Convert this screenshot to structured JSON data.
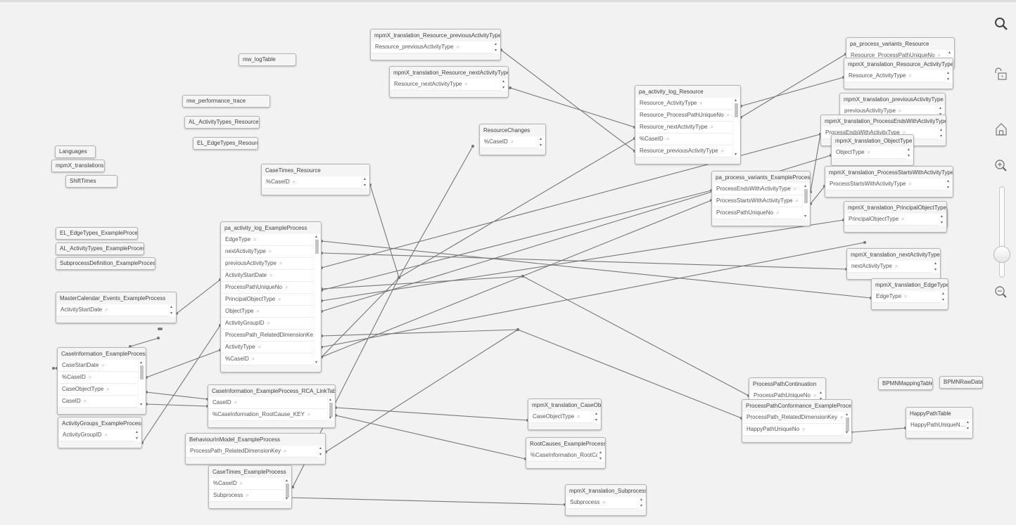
{
  "tables": [
    {
      "name": "mw_logTable",
      "fields": []
    },
    {
      "name": "mw_performance_trace",
      "fields": []
    },
    {
      "name": "AL_ActivityTypes_Resource",
      "fields": []
    },
    {
      "name": "EL_EdgeTypes_Resource",
      "fields": []
    },
    {
      "name": "Languages",
      "fields": []
    },
    {
      "name": "mpmX_translations",
      "fields": []
    },
    {
      "name": "ShiftTimes",
      "fields": []
    },
    {
      "name": "EL_EdgeTypes_ExampleProcess",
      "fields": []
    },
    {
      "name": "AL_ActivityTypes_ExampleProcess",
      "fields": []
    },
    {
      "name": "SubprocessDefinition_ExampleProcess",
      "fields": []
    },
    {
      "name": "BPMNMappingTable",
      "fields": []
    },
    {
      "name": "BPMNRawData",
      "fields": []
    },
    {
      "name": "mpmX_translation_Resource_previousActivityType",
      "fields": [
        "Resource_previousActivityType"
      ]
    },
    {
      "name": "mpmX_translation_Resource_nextActivityType",
      "fields": [
        "Resource_nextActivityType"
      ]
    },
    {
      "name": "ResourceChanges",
      "fields": [
        "%CaseID"
      ]
    },
    {
      "name": "pa_activity_log_Resource",
      "fields": [
        "Resource_ActivityType",
        "Resource_ProcessPathUniqueNo",
        "Resource_nextActivityType",
        "%CaseID",
        "Resource_previousActivityType"
      ]
    },
    {
      "name": "CaseTimes_Resource",
      "fields": [
        "%CaseID"
      ]
    },
    {
      "name": "pa_process_variants_Resource",
      "fields": [
        "Resource_ProcessPathUniqueNo"
      ]
    },
    {
      "name": "mpmX_translation_Resource_ActivityType",
      "fields": [
        "Resource_ActivityType"
      ]
    },
    {
      "name": "mpmX_translation_previousActivityType",
      "fields": [
        "previousActivityType"
      ]
    },
    {
      "name": "mpmX_translation_ProcessEndsWithActivityType",
      "fields": [
        "ProcessEndsWithActivityType"
      ]
    },
    {
      "name": "mpmX_translation_ObjectType",
      "fields": [
        "ObjectType"
      ]
    },
    {
      "name": "mpmX_translation_ProcessStartsWithActivityType",
      "fields": [
        "ProcessStartsWithActivityType"
      ]
    },
    {
      "name": "pa_process_variants_ExampleProcess",
      "fields": [
        "ProcessEndsWithActivityType",
        "ProcessStartsWithActivityType",
        "ProcessPathUniqueNo"
      ]
    },
    {
      "name": "",
      "fields": [
        "ActivityType"
      ]
    },
    {
      "name": "mpmX_translation_PrincipalObjectType",
      "fields": [
        "PrincipalObjectType"
      ]
    },
    {
      "name": "mpmX_translation_nextActivityType",
      "fields": [
        "nextActivityType"
      ]
    },
    {
      "name": "mpmX_translation_EdgeType",
      "fields": [
        "EdgeType"
      ]
    },
    {
      "name": "pa_activity_log_ExampleProcess",
      "fields": [
        "EdgeType",
        "nextActivityType",
        "previousActivityType",
        "ActivityStartDate",
        "ProcessPathUniqueNo",
        "PrincipalObjectType",
        "ObjectType",
        "ActivityGroupID",
        "ProcessPath_RelatedDimensionKe...",
        "ActivityType",
        "%CaseID"
      ]
    },
    {
      "name": "",
      "fields": [
        "CaseStartDate"
      ]
    },
    {
      "name": "MasterCalendar_Events_ExampleProcess",
      "fields": [
        "ActivityStartDate"
      ]
    },
    {
      "name": "CaseInformation_ExampleProcess",
      "fields": [
        "CaseStartDate",
        "%CaseID",
        "CaseObjectType",
        "CaseID"
      ]
    },
    {
      "name": "ActivityGroups_ExampleProcess",
      "fields": [
        "ActivityGroupID"
      ]
    },
    {
      "name": "CaseInformation_ExampleProcess_RCA_LinkTable",
      "fields": [
        "CaseID",
        "%CaseInformation_RootCause_KEY"
      ]
    },
    {
      "name": "BehaviourInModel_ExampleProcess",
      "fields": [
        "ProcessPath_RelatedDimensionKey"
      ]
    },
    {
      "name": "CaseTimes_ExampleProcess",
      "fields": [
        "%CaseID",
        "Subprocess"
      ]
    },
    {
      "name": "mpmX_translation_CaseObjectType",
      "fields": [
        "CaseObjectType"
      ]
    },
    {
      "name": "RootCauses_ExampleProcess",
      "fields": [
        "%CaseInformation_RootCause_KE..."
      ]
    },
    {
      "name": "mpmX_translation_Subprocess",
      "fields": [
        "Subprocess"
      ]
    },
    {
      "name": "ProcessPathContinuation",
      "fields": [
        "ProcessPathUniqueNo"
      ]
    },
    {
      "name": "ProcessPathConformance_ExampleProcess",
      "fields": [
        "ProcessPath_RelatedDimensionKey",
        "HappyPathUniqueNo"
      ]
    },
    {
      "name": "HappyPathTable",
      "fields": [
        "HappyPathUniqueN..."
      ]
    }
  ],
  "toolbar": {
    "icons": [
      "search-icon",
      "unlock-icon",
      "home-icon",
      "zoom-in-icon",
      "zoom-slider",
      "zoom-out-icon"
    ],
    "zoom_level_fraction": 0.75
  },
  "colors": {
    "background": "#f2f2f2",
    "link": "#777777",
    "table_border": "#b5b5b5"
  }
}
